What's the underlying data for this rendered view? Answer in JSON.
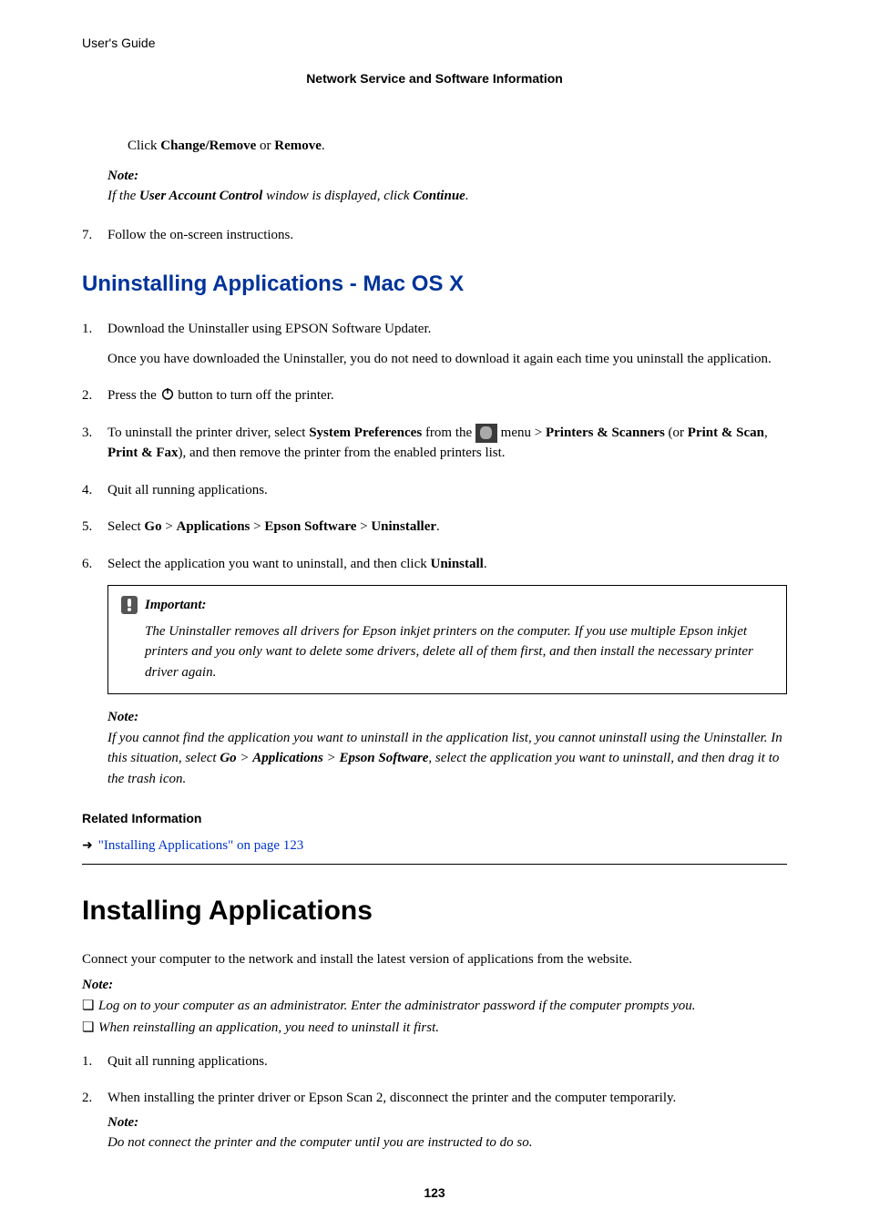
{
  "header": {
    "guide": "User's Guide"
  },
  "breadcrumb": "Network Service and Software Information",
  "windows_tail": {
    "click_line": {
      "pre": "Click ",
      "b1": "Change/Remove",
      "mid": " or ",
      "b2": "Remove",
      "post": "."
    },
    "note_label": "Note:",
    "note_body": {
      "pre": "If the ",
      "b1": "User Account Control",
      "mid": " window is displayed, click ",
      "b2": "Continue",
      "post": "."
    },
    "step7_num": "7.",
    "step7_txt": "Follow the on-screen instructions."
  },
  "mac_section": {
    "title": "Uninstalling Applications - Mac OS X",
    "s1": {
      "num": "1.",
      "p1": "Download the Uninstaller using EPSON Software Updater.",
      "p2": "Once you have downloaded the Uninstaller, you do not need to download it again each time you uninstall the application."
    },
    "s2": {
      "num": "2.",
      "pre": "Press the ",
      "post": " button to turn off the printer."
    },
    "s3": {
      "num": "3.",
      "pre": "To uninstall the printer driver, select ",
      "b1": "System Preferences",
      "mid1": " from the ",
      "mid2": " menu > ",
      "b2": "Printers & Scanners",
      "mid3": " (or ",
      "b3": "Print & Scan",
      "mid4": ", ",
      "b4": "Print & Fax",
      "post": "), and then remove the printer from the enabled printers list."
    },
    "s4": {
      "num": "4.",
      "txt": "Quit all running applications."
    },
    "s5": {
      "num": "5.",
      "pre": "Select ",
      "b1": "Go",
      "gt1": " > ",
      "b2": "Applications",
      "gt2": " > ",
      "b3": "Epson Software",
      "gt3": " > ",
      "b4": "Uninstaller",
      "post": "."
    },
    "s6": {
      "num": "6.",
      "pre": "Select the application you want to uninstall, and then click ",
      "b1": "Uninstall",
      "post": "."
    },
    "important": {
      "label": "Important:",
      "body": "The Uninstaller removes all drivers for Epson inkjet printers on the computer. If you use multiple Epson inkjet printers and you only want to delete some drivers, delete all of them first, and then install the necessary printer driver again."
    },
    "note_label": "Note:",
    "note_body": {
      "pre": "If you cannot find the application you want to uninstall in the application list, you cannot uninstall using the Uninstaller. In this situation, select ",
      "b1": "Go",
      "gt1": " > ",
      "b2": "Applications",
      "gt2": " > ",
      "b3": "Epson Software",
      "post": ", select the application you want to uninstall, and then drag it to the trash icon."
    },
    "related_label": "Related Information",
    "related_link": "\"Installing Applications\" on page 123"
  },
  "install_section": {
    "title": "Installing Applications",
    "intro": "Connect your computer to the network and install the latest version of applications from the website.",
    "note_label": "Note:",
    "bullets": {
      "b1": "Log on to your computer as an administrator. Enter the administrator password if the computer prompts you.",
      "b2": "When reinstalling an application, you need to uninstall it first."
    },
    "s1": {
      "num": "1.",
      "txt": "Quit all running applications."
    },
    "s2": {
      "num": "2.",
      "p1": "When installing the printer driver or Epson Scan 2, disconnect the printer and the computer temporarily.",
      "note_label": "Note:",
      "note_body": "Do not connect the printer and the computer until you are instructed to do so."
    }
  },
  "page_number": "123"
}
